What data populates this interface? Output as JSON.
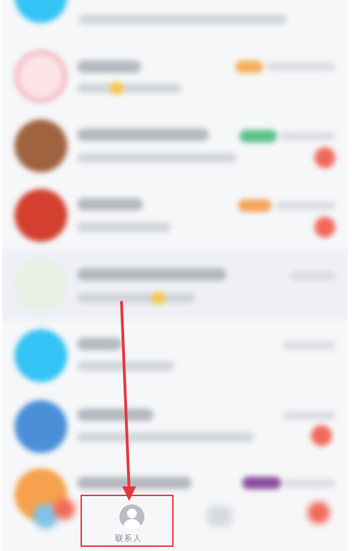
{
  "tabbar": {
    "contacts_label": "联系人"
  },
  "colors": {
    "annotation_red": "#e8343c",
    "list_bg": "#f6f7f9",
    "badge_red": "#f06a5b",
    "avatar_blue": "#33c3f5"
  },
  "icons": {
    "contacts_tab": "person-icon",
    "annotation": "red-arrow"
  }
}
